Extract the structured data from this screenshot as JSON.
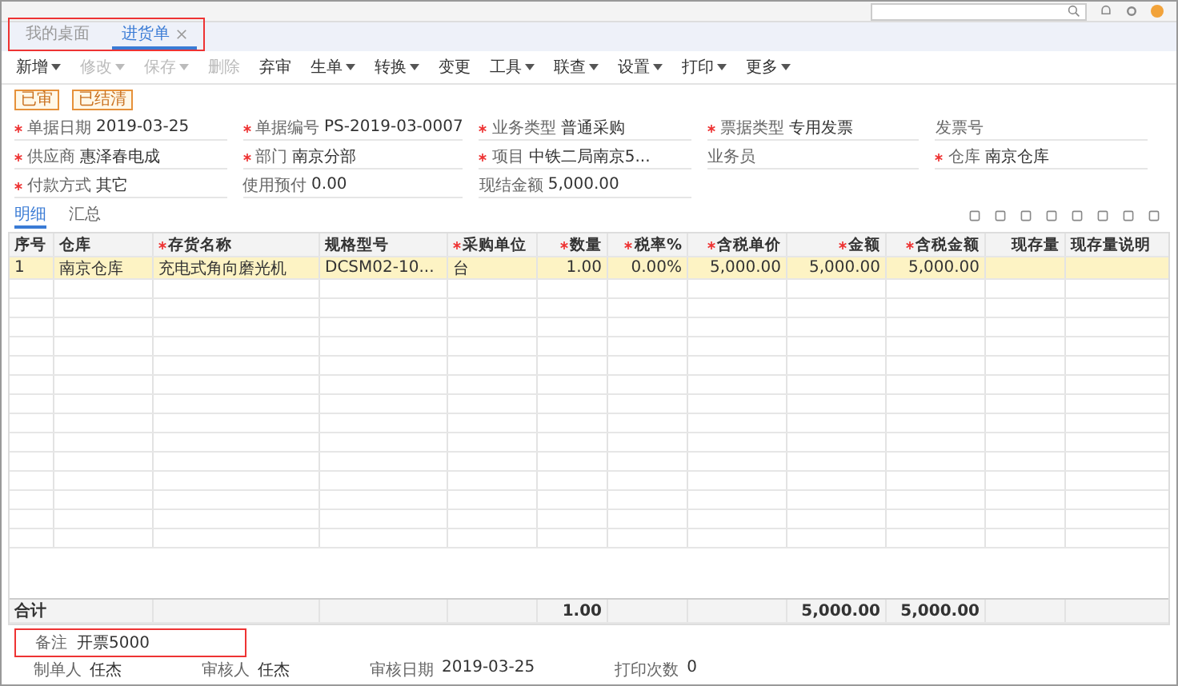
{
  "tabs": [
    {
      "label": "我的桌面",
      "selected": false,
      "closable": false
    },
    {
      "label": "进货单",
      "selected": true,
      "closable": true
    }
  ],
  "tabs_highlighted": true,
  "toolbar": [
    {
      "label": "新增",
      "dropdown": true,
      "disabled": false
    },
    {
      "label": "修改",
      "dropdown": true,
      "disabled": true
    },
    {
      "label": "保存",
      "dropdown": true,
      "disabled": true
    },
    {
      "label": "删除",
      "dropdown": false,
      "disabled": true
    },
    {
      "label": "弃审",
      "dropdown": false,
      "disabled": false
    },
    {
      "label": "生单",
      "dropdown": true,
      "disabled": false
    },
    {
      "label": "转换",
      "dropdown": true,
      "disabled": false
    },
    {
      "label": "变更",
      "dropdown": false,
      "disabled": false
    },
    {
      "label": "工具",
      "dropdown": true,
      "disabled": false
    },
    {
      "label": "联查",
      "dropdown": true,
      "disabled": false
    },
    {
      "label": "设置",
      "dropdown": true,
      "disabled": false
    },
    {
      "label": "打印",
      "dropdown": true,
      "disabled": false
    },
    {
      "label": "更多",
      "dropdown": true,
      "disabled": false
    }
  ],
  "status_tags": [
    "已审",
    "已结清"
  ],
  "fields": [
    {
      "label": "单据日期",
      "value": "2019-03-25",
      "required": true
    },
    {
      "label": "单据编号",
      "value": "PS-2019-03-0007",
      "required": true
    },
    {
      "label": "业务类型",
      "value": "普通采购",
      "required": true
    },
    {
      "label": "票据类型",
      "value": "专用发票",
      "required": true
    },
    {
      "label": "发票号",
      "required": false
    },
    {
      "label": "供应商",
      "value": "惠泽春电成",
      "required": true
    },
    {
      "label": "部门",
      "value": "南京分部",
      "required": true
    },
    {
      "label": "项目",
      "value": "中铁二局南京5...",
      "required": true
    },
    {
      "label": "业务员",
      "required": false
    },
    {
      "label": "仓库",
      "value": "南京仓库",
      "required": true
    },
    {
      "label": "付款方式",
      "value": "其它",
      "required": true
    },
    {
      "label": "使用预付",
      "value": "0.00",
      "required": false
    },
    {
      "label": "现结金额",
      "value": "5,000.00",
      "required": false
    }
  ],
  "subtabs": [
    {
      "label": "明细",
      "selected": true
    },
    {
      "label": "汇总",
      "selected": false
    }
  ],
  "table": {
    "columns": [
      {
        "label": "序号",
        "required": false
      },
      {
        "label": "仓库",
        "required": false
      },
      {
        "label": "存货名称",
        "required": true
      },
      {
        "label": "规格型号",
        "required": false
      },
      {
        "label": "采购单位",
        "required": true
      },
      {
        "label": "数量",
        "required": true
      },
      {
        "label": "税率%",
        "required": true
      },
      {
        "label": "含税单价",
        "required": true
      },
      {
        "label": "金额",
        "required": true
      },
      {
        "label": "含税金额",
        "required": true
      },
      {
        "label": "现存量",
        "required": false
      },
      {
        "label": "现存量说明",
        "required": false
      }
    ],
    "rows": [
      {
        "selected": true,
        "cells": [
          "1",
          "南京仓库",
          "充电式角向磨光机",
          "DCSM02-10...",
          "台",
          "1.00",
          "0.00%",
          "5,000.00",
          "5,000.00",
          "5,000.00",
          "",
          ""
        ]
      }
    ],
    "totals": {
      "label": "合计",
      "cells": [
        "",
        "",
        "",
        "",
        "",
        "1.00",
        "",
        "",
        "5,000.00",
        "5,000.00",
        "",
        ""
      ]
    }
  },
  "remark": {
    "label": "备注",
    "value": "开票5000",
    "highlighted": true
  },
  "footer": [
    {
      "label": "制单人",
      "value": "任杰"
    },
    {
      "label": "审核人",
      "value": "任杰"
    },
    {
      "label": "审核日期",
      "value": "2019-03-25"
    },
    {
      "label": "打印次数",
      "value": "0"
    }
  ]
}
